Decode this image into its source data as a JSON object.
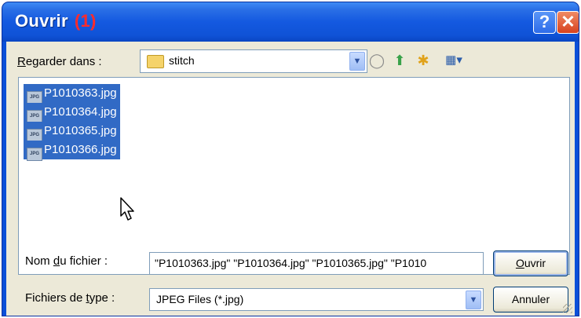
{
  "window": {
    "title": "Ouvrir",
    "number": "(1)"
  },
  "titlebar_buttons": {
    "help": "?",
    "close": "✕"
  },
  "look_in": {
    "label_accel": "R",
    "label_rest": "egarder dans :",
    "value": "stitch"
  },
  "toolbar": {
    "back_icon": "◯",
    "up_icon": "⬆",
    "newfolder_icon": "✱",
    "view_icon": "▦▾"
  },
  "files": [
    "P1010363.jpg",
    "P1010364.jpg",
    "P1010365.jpg",
    "P1010366.jpg"
  ],
  "file_icon_text": "JPG",
  "filename": {
    "label_pre": "Nom ",
    "label_accel": "d",
    "label_post": "u fichier :",
    "value": "\"P1010363.jpg\" \"P1010364.jpg\" \"P1010365.jpg\" \"P1010"
  },
  "filetype": {
    "label_pre": "Fichiers de ",
    "label_accel": "t",
    "label_post": "ype :",
    "value": "JPEG Files (*.jpg)"
  },
  "buttons": {
    "open_accel": "O",
    "open_rest": "uvrir",
    "cancel": "Annuler"
  }
}
